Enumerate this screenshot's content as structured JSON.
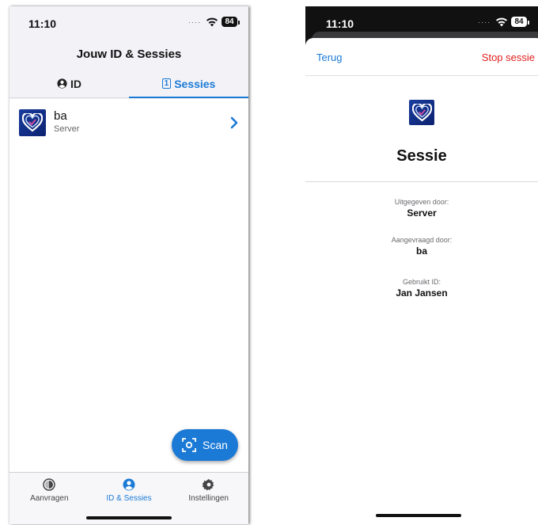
{
  "status_bar": {
    "time": "11:10",
    "battery": "84"
  },
  "colors": {
    "accent": "#1b7ad6",
    "danger": "#e01d1d"
  },
  "left": {
    "title": "Jouw ID & Sessies",
    "tabs": [
      {
        "label": "ID",
        "icon": "user-circle-icon",
        "active": false
      },
      {
        "label": "Sessies",
        "badge": "1",
        "icon": "count-badge",
        "active": true
      }
    ],
    "sessions": [
      {
        "title": "ba",
        "subtitle": "Server",
        "icon": "heart-logo-icon"
      }
    ],
    "scan_button": {
      "label": "Scan",
      "icon": "scan-icon"
    },
    "bottom_nav": [
      {
        "label": "Aanvragen",
        "icon": "requests-icon",
        "active": false
      },
      {
        "label": "ID & Sessies",
        "icon": "user-circle-icon",
        "active": true
      },
      {
        "label": "Instellingen",
        "icon": "gear-icon",
        "active": false
      }
    ]
  },
  "right": {
    "back_label": "Terug",
    "stop_label": "Stop sessie",
    "title": "Sessie",
    "fields": [
      {
        "label": "Uitgegeven door:",
        "value": "Server"
      },
      {
        "label": "Aangevraagd door:",
        "value": "ba"
      },
      {
        "label": "Gebruikt ID:",
        "value": "Jan Jansen"
      }
    ]
  }
}
